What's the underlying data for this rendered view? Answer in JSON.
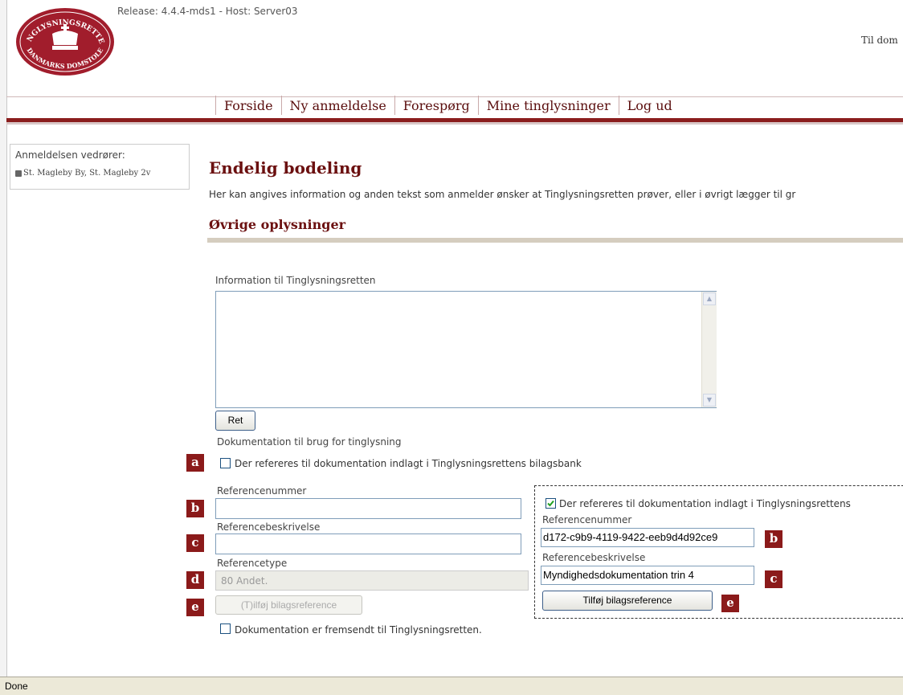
{
  "header": {
    "release_text": "Release: 4.4.4-mds1 - Host: Server03",
    "right_link": "Til dom",
    "logo": {
      "top_text": "TINGLYSNINGSRETTEN",
      "bottom_text": "DANMARKS DOMSTOLE",
      "icon": "crown-logo-icon",
      "color": "#a11d2c"
    }
  },
  "nav": {
    "items": [
      "Forside",
      "Ny anmeldelse",
      "Forespørg",
      "Mine tinglysninger",
      "Log ud"
    ]
  },
  "sidebar": {
    "title": "Anmeldelsen vedrører:",
    "property": "St. Magleby By, St. Magleby 2v"
  },
  "main": {
    "title": "Endelig bodeling",
    "intro": "Her kan angives information og anden tekst som anmelder ønsker at Tinglysningsretten prøver, eller i øvrigt lægger til gr",
    "section_title": "Øvrige oplysninger",
    "info_label": "Information til Tinglysningsretten",
    "ret_button": "Ret",
    "doc_label": "Dokumentation til brug for tinglysning",
    "checkbox_bilagsbank": "Der refereres til dokumentation indlagt i Tinglysningsrettens bilagsbank",
    "ref_number_label": "Referencenummer",
    "ref_desc_label": "Referencebeskrivelse",
    "ref_type_label": "Referencetype",
    "ref_type_value": "80 Andet.",
    "add_button": "(T)ilføj bilagsreference",
    "checkbox_sent": "Dokumentation er fremsendt til Tinglysningsretten."
  },
  "markers": [
    "a",
    "b",
    "c",
    "d",
    "e"
  ],
  "callout": {
    "checkbox_text": "Der refereres til dokumentation indlagt i Tinglysningsrettens",
    "ref_number_label": "Referencenummer",
    "ref_number_value": "d172-c9b9-4119-9422-eeb9d4d92ce9",
    "ref_desc_label": "Referencebeskrivelse",
    "ref_desc_value": "Myndighedsdokumentation trin 4",
    "add_button": "Tilføj bilagsreference",
    "markers": [
      "b",
      "c",
      "e"
    ]
  },
  "status_bar": {
    "text": "Done"
  },
  "colors": {
    "brand": "#8b1d1d",
    "heading": "#6b1010",
    "marker": "#8b1a1a"
  }
}
